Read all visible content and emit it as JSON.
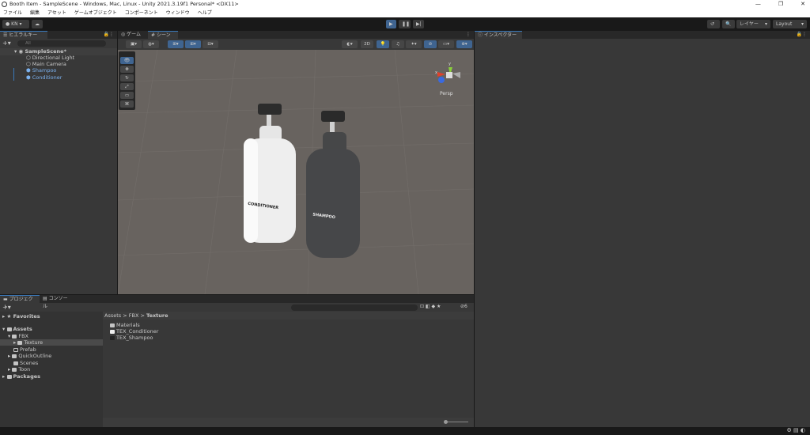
{
  "window": {
    "title": "Booth Item - SampleScene - Windows, Mac, Linux - Unity 2021.3.19f1 Personal* <DX11>",
    "min": "—",
    "max": "❐",
    "close": "✕"
  },
  "menu": [
    "ファイル",
    "編集",
    "アセット",
    "ゲームオブジェクト",
    "コンポーネント",
    "ウィンドウ",
    "ヘルプ"
  ],
  "toolbar": {
    "account": "KN ▾",
    "cloud": "☁",
    "play": "▶",
    "pause": "❚❚",
    "step": "▶|",
    "history": "↺",
    "search": "🔍",
    "layers": "レイヤー",
    "layout": "Layout"
  },
  "hierarchy": {
    "tab": "ヒエラルキー",
    "search_placeholder": "All",
    "add": "+▾",
    "scene": "SampleScene*",
    "items": [
      {
        "label": "Directional Light",
        "prefab": false
      },
      {
        "label": "Main Camera",
        "prefab": false
      },
      {
        "label": "Shampoo",
        "prefab": true
      },
      {
        "label": "Conditioner",
        "prefab": true
      }
    ]
  },
  "scene": {
    "tabs": [
      "ゲーム",
      "シーン"
    ],
    "toggle_2d": "2D",
    "persp": "Persp",
    "gizmo_y": "y",
    "gizmo_x": "x",
    "bottle_labels": [
      "CONDITIONER",
      "SHAMPOO"
    ]
  },
  "inspector": {
    "tab": "インスペクター"
  },
  "project": {
    "tabs": [
      "プロジェクト",
      "コンソール"
    ],
    "add": "+▾",
    "favorites": "Favorites",
    "tree": [
      {
        "label": "Assets",
        "bold": true,
        "depth": 0
      },
      {
        "label": "FBX",
        "depth": 1
      },
      {
        "label": "Texture",
        "depth": 2,
        "selected": true
      },
      {
        "label": "Prefab",
        "depth": 1
      },
      {
        "label": "QuickOutline",
        "depth": 1
      },
      {
        "label": "Scenes",
        "depth": 1
      },
      {
        "label": "Toon",
        "depth": 1
      },
      {
        "label": "Packages",
        "bold": true,
        "depth": 0
      }
    ],
    "breadcrumb": [
      "Assets",
      "FBX",
      "Texture"
    ],
    "files": [
      "Materials",
      "TEX_Conditioner",
      "TEX_Shampoo"
    ],
    "hidden_count": "6"
  }
}
